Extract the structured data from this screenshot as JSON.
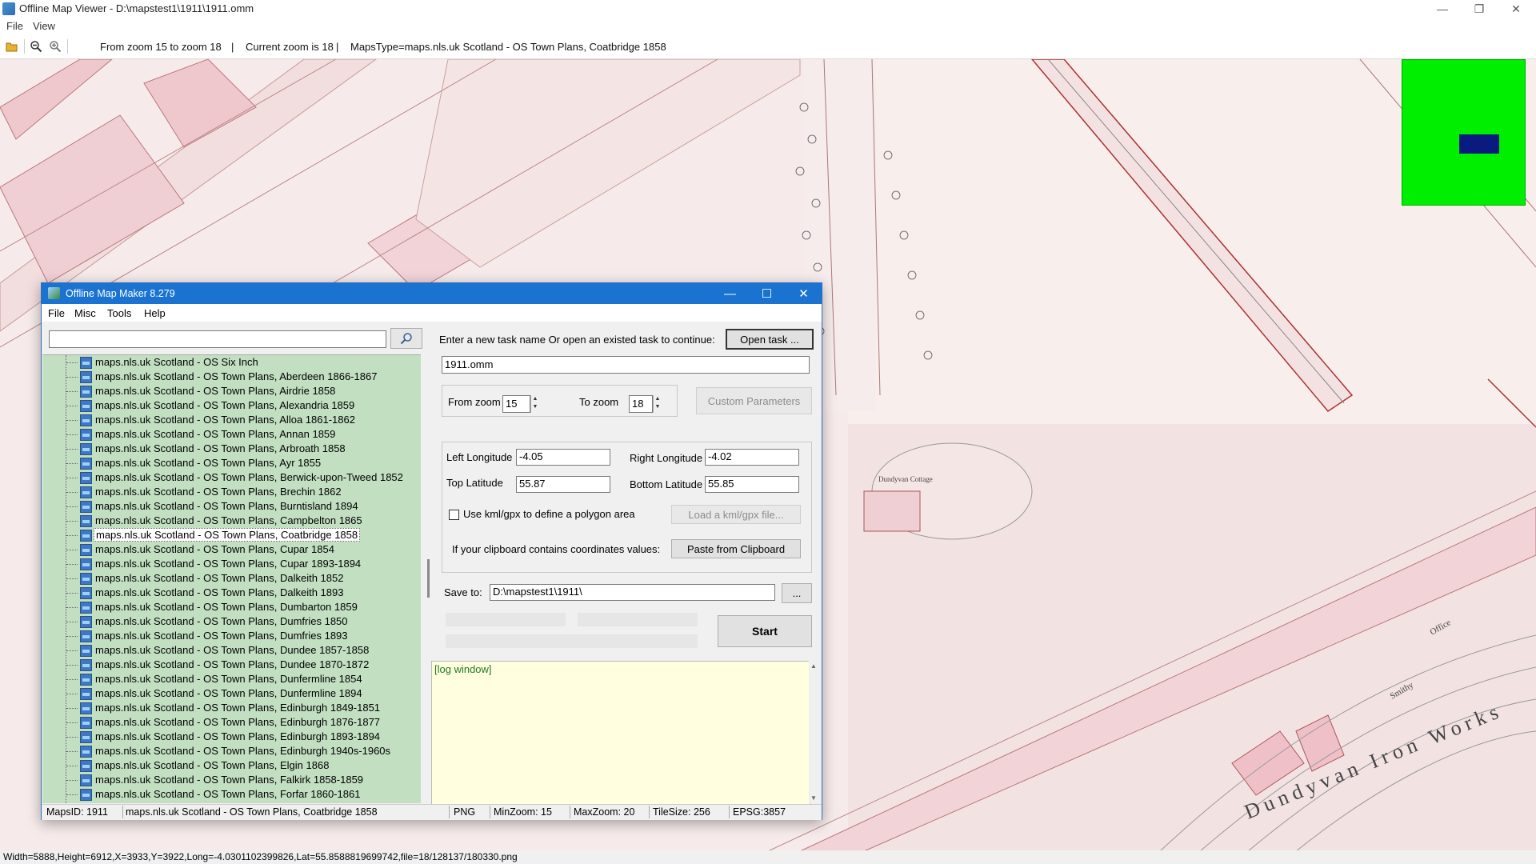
{
  "window": {
    "title": "Offline Map Viewer - D:\\mapstest1\\1911\\1911.omm",
    "minimize": "—",
    "maximize": "❐",
    "close": "✕"
  },
  "menu": [
    "File",
    "View"
  ],
  "toolbar": {
    "zoom_range": "From zoom 15 to zoom 18",
    "sep1": "|",
    "current_zoom": "Current zoom is 18",
    "sep2": "|",
    "maps_type": "MapsType=maps.nls.uk Scotland - OS Town Plans, Coatbridge 1858"
  },
  "map": {
    "labels": [
      "Dundyvan Iron Works",
      "Dundyvan Cottage",
      "Smithy",
      "Office"
    ]
  },
  "status": "Width=5888,Height=6912,X=3933,Y=3922,Long=-4.0301102399826,Lat=55.8588819699742,file=18/128137/180330.png",
  "dialog": {
    "title": "Offline Map Maker 8.279",
    "minimize": "—",
    "maximize": "☐",
    "close": "✕",
    "menu": [
      "File",
      "Misc",
      "Tools",
      "Help"
    ],
    "search_value": "",
    "tree_items": [
      "maps.nls.uk Scotland - OS Six Inch",
      "maps.nls.uk Scotland - OS Town Plans, Aberdeen 1866-1867",
      "maps.nls.uk Scotland - OS Town Plans, Airdrie 1858",
      "maps.nls.uk Scotland - OS Town Plans, Alexandria 1859",
      "maps.nls.uk Scotland - OS Town Plans, Alloa 1861-1862",
      "maps.nls.uk Scotland - OS Town Plans, Annan 1859",
      "maps.nls.uk Scotland - OS Town Plans, Arbroath 1858",
      "maps.nls.uk Scotland - OS Town Plans, Ayr 1855",
      "maps.nls.uk Scotland - OS Town Plans, Berwick-upon-Tweed 1852",
      "maps.nls.uk Scotland - OS Town Plans, Brechin 1862",
      "maps.nls.uk Scotland - OS Town Plans, Burntisland 1894",
      "maps.nls.uk Scotland - OS Town Plans, Campbelton 1865",
      "maps.nls.uk Scotland - OS Town Plans, Coatbridge 1858",
      "maps.nls.uk Scotland - OS Town Plans, Cupar 1854",
      "maps.nls.uk Scotland - OS Town Plans, Cupar 1893-1894",
      "maps.nls.uk Scotland - OS Town Plans, Dalkeith 1852",
      "maps.nls.uk Scotland - OS Town Plans, Dalkeith 1893",
      "maps.nls.uk Scotland - OS Town Plans, Dumbarton 1859",
      "maps.nls.uk Scotland - OS Town Plans, Dumfries 1850",
      "maps.nls.uk Scotland - OS Town Plans, Dumfries 1893",
      "maps.nls.uk Scotland - OS Town Plans, Dundee 1857-1858",
      "maps.nls.uk Scotland - OS Town Plans, Dundee 1870-1872",
      "maps.nls.uk Scotland - OS Town Plans, Dunfermline 1854",
      "maps.nls.uk Scotland - OS Town Plans, Dunfermline 1894",
      "maps.nls.uk Scotland - OS Town Plans, Edinburgh 1849-1851",
      "maps.nls.uk Scotland - OS Town Plans, Edinburgh 1876-1877",
      "maps.nls.uk Scotland - OS Town Plans, Edinburgh 1893-1894",
      "maps.nls.uk Scotland - OS Town Plans, Edinburgh 1940s-1960s",
      "maps.nls.uk Scotland - OS Town Plans, Elgin 1868",
      "maps.nls.uk Scotland - OS Town Plans, Falkirk 1858-1859",
      "maps.nls.uk Scotland - OS Town Plans, Forfar 1860-1861"
    ],
    "selected_index": 12,
    "task_prompt": "Enter a new task name Or open an existed task to continue:",
    "open_task_label": "Open task ...",
    "task_name": "1911.omm",
    "from_zoom_label": "From zoom",
    "from_zoom": "15",
    "to_zoom_label": "To zoom",
    "to_zoom": "18",
    "custom_params_label": "Custom Parameters",
    "left_lon_label": "Left Longitude",
    "left_lon": "-4.05",
    "right_lon_label": "Right Longitude",
    "right_lon": "-4.02",
    "top_lat_label": "Top Latitude",
    "top_lat": "55.87",
    "bottom_lat_label": "Bottom Latitude",
    "bottom_lat": "55.85",
    "kml_check_label": "Use kml/gpx to define a polygon area",
    "load_kml_label": "Load a kml/gpx file...",
    "clipboard_label": "If your clipboard contains coordinates values:",
    "paste_label": "Paste from Clipboard",
    "save_to_label": "Save to:",
    "save_to": "D:\\mapstest1\\1911\\",
    "browse_label": "...",
    "start_label": "Start",
    "log_text": "[log window]",
    "status": {
      "maps_id": "MapsID: 1911",
      "maps_name": "maps.nls.uk Scotland - OS Town Plans, Coatbridge 1858",
      "format": "PNG",
      "min_zoom": "MinZoom: 15",
      "max_zoom": "MaxZoom: 20",
      "tile_size": "TileSize: 256",
      "epsg": "EPSG:3857"
    }
  },
  "colors": {
    "map_bg": "#f6eaea",
    "tree_bg": "#c2dfc2",
    "log_bg": "#ffffe0",
    "title_blue": "#1a73d1",
    "minimap_green": "#00ee00",
    "minimap_viewport": "#0a1a80"
  }
}
